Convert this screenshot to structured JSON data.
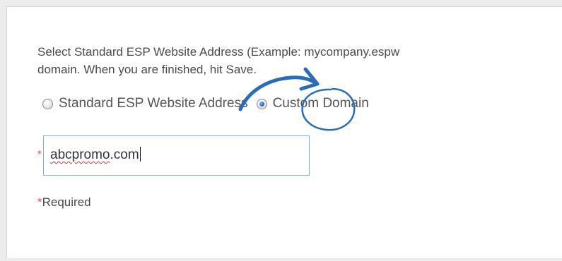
{
  "form": {
    "instructions_line1": "Select Standard ESP Website Address (Example: mycompany.espw",
    "instructions_line2": "domain. When you are finished, hit Save.",
    "radio_options": [
      {
        "label": "Standard ESP Website Address",
        "checked": false
      },
      {
        "label": "Custom Domain",
        "checked": true
      }
    ],
    "required_marker": "*",
    "domain_input": {
      "value_misspelled": "abcpromo",
      "value_rest": ".com"
    },
    "required_note": "Required"
  },
  "colors": {
    "text": "#4a4a4a",
    "required": "#d9534f",
    "input_border": "#7db4e6",
    "annotation_ink": "#2b6cb8"
  },
  "annotation": {
    "arrow_icon": "hand-drawn-arrow",
    "circle_icon": "hand-drawn-circle"
  }
}
